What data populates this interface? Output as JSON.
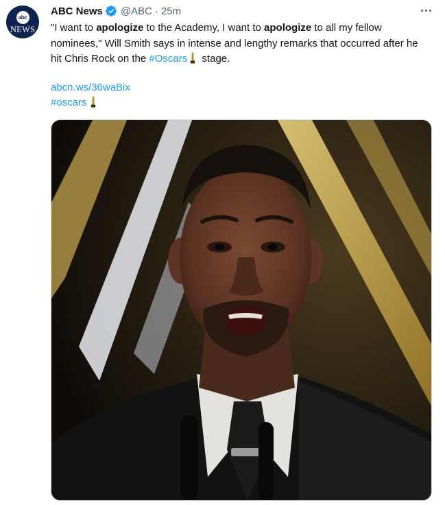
{
  "author": {
    "avatar_top": "abc",
    "avatar_bottom": "NEWS",
    "display_name": "ABC News",
    "handle": "@ABC",
    "separator": "·",
    "time": "25m"
  },
  "tweet": {
    "part1": "\"I want to ",
    "bold1": "apologize",
    "part2": " to the Academy, I want to ",
    "bold2": "apologize",
    "part3": " to all my fellow nominees,\" Will Smith says in intense and lengthy remarks that occurred after he hit Chris Rock on the ",
    "hashtag1": "#Oscars",
    "part4": " stage.",
    "link": "abcn.ws/36waBix",
    "hashtag2": "#oscars"
  },
  "colors": {
    "accent": "#1d9bf0",
    "text": "#0f1419",
    "muted": "#536471",
    "avatar_bg": "#0d2450"
  },
  "icons": [
    "verified-badge-icon",
    "more-options-icon",
    "oscar-trophy-emoji"
  ]
}
